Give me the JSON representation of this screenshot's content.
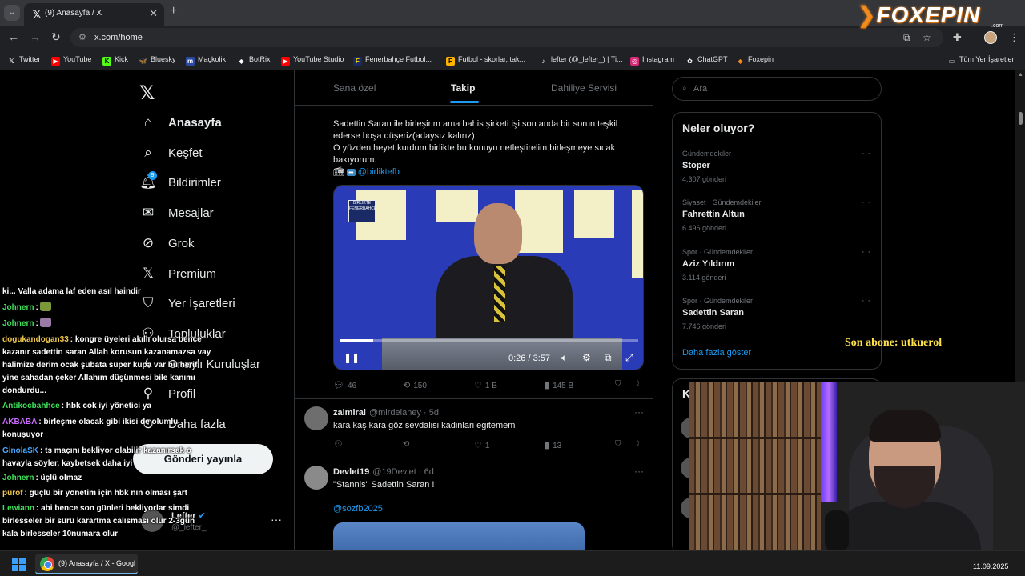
{
  "browser": {
    "tab_title": "(9) Anasayfa / X",
    "url": "x.com/home",
    "bookmarks": [
      "Twitter",
      "YouTube",
      "Kick",
      "Bluesky",
      "Maçkolik",
      "BotRix",
      "YouTube Studio",
      "Fenerbahçe Futbol...",
      "Futbol - skorlar, tak...",
      "lefter (@_lefter_) | Ti...",
      "Instagram",
      "ChatGPT",
      "Foxepin"
    ],
    "all_bookmarks": "Tüm Yer İşaretleri"
  },
  "sidebar": {
    "items": [
      "Anasayfa",
      "Keşfet",
      "Bildirimler",
      "Mesajlar",
      "Grok",
      "Premium",
      "Yer İşaretleri",
      "Topluluklar",
      "Onaylı Kuruluşlar",
      "Profil",
      "Daha fazla"
    ],
    "notification_badge": "9",
    "post_button": "Gönderi yayınla",
    "account_name": "Lefter",
    "account_handle": "@_lefter_"
  },
  "feed_tabs": [
    "Sana özel",
    "Takip",
    "Dahiliye Servisi"
  ],
  "tweet1": {
    "text": "Sadettin Saran ile birleşirim ama bahis şirketi işi son anda bir sorun teşkil ederse boşa düşeriz(adaysız kalırız)\nO yüzden heyet kurdum birlikte bu konuyu netleştirelim birleşmeye sıcak bakıyorum.",
    "mention": "@birliktefb",
    "video_time": "0:26 / 3:57",
    "video_progress": 0.11,
    "replies": "46",
    "reposts": "150",
    "likes": "1 B",
    "views": "145 B"
  },
  "tweet2": {
    "name": "zaimiral",
    "meta": "@mirdelaney · 5d",
    "text": "kara kaş kara göz sevdalisi kadinlari egitemem",
    "likes": "1",
    "views": "13"
  },
  "tweet3": {
    "name": "Devlet19",
    "meta": "@19Devlet · 6d",
    "text": "\"Stannis\" Sadettin Saran !",
    "mention": "@sozfb2025"
  },
  "search": {
    "placeholder": "Ara"
  },
  "trends": {
    "heading": "Neler oluyor?",
    "items": [
      {
        "category": "Gündemdekiler",
        "name": "Stoper",
        "count": "4.307 gönderi"
      },
      {
        "category": "Siyaset · Gündemdekiler",
        "name": "Fahrettin Altun",
        "count": "6.496 gönderi"
      },
      {
        "category": "Spor · Gündemdekiler",
        "name": "Aziz Yıldırım",
        "count": "3.114 gönderi"
      },
      {
        "category": "Spor · Gündemdekiler",
        "name": "Sadettin Saran",
        "count": "7.746 gönderi"
      }
    ],
    "show_more": "Daha fazla göster"
  },
  "who_to_follow": {
    "heading": "Ki"
  },
  "stream": {
    "brand": "FOXEPIN",
    "brand_sub": ".com",
    "last_sub": "Son abone: utkuerol",
    "chat": [
      {
        "user": "",
        "msg": "ki... Valla adama laf eden asıl haindir",
        "color": "#ffffff"
      },
      {
        "user": "Johnern",
        "msg": ":",
        "color": "#3ee05a"
      },
      {
        "user": "Johnern",
        "msg": ":",
        "color": "#3ee05a"
      },
      {
        "user": "dogukandogan33",
        "msg": ": kongre üyeleri akıllı olursa bence kazanır sadettin saran Allah korusun kazanamazsa vay halimize derim ocak şubata süper kupa var bu herif yine sahadan çeker Allahım düşünmesi bile kanımı dondurdu...",
        "color": "#f2c94c"
      },
      {
        "user": "Antikocbahhce",
        "msg": ": hbk cok iyi yönetici ya",
        "color": "#3ee05a"
      },
      {
        "user": "AKBABA",
        "msg": ": birleşme olacak gibi ikisi de olumlu konuşuyor",
        "color": "#c86bff"
      },
      {
        "user": "GinolaSK",
        "msg": ": ts maçını bekliyor olabilir kazanırsak o havayla söyler, kaybetsek daha iyi",
        "color": "#4aa8ff"
      },
      {
        "user": "Johnern",
        "msg": ": üçlü olmaz",
        "color": "#3ee05a"
      },
      {
        "user": "purof",
        "msg": ": güçlü bir yönetim için hbk nın olması şart",
        "color": "#f2c94c"
      },
      {
        "user": "Lewiann",
        "msg": ": abi bence son günleri bekliyorlar simdi birlesseler bir sürü karartma calısması olur 2-3gün kala birlesseler 10numara olur",
        "color": "#3ee05a"
      }
    ]
  },
  "taskbar": {
    "app_label": "(9) Anasayfa / X - Googl",
    "date": "11.09.2025"
  }
}
